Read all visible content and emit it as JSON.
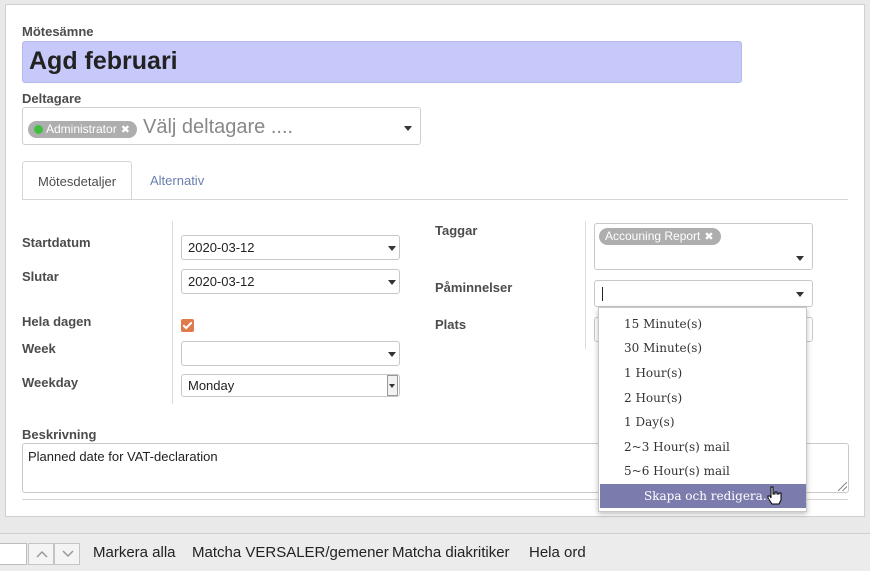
{
  "form": {
    "subject_label": "Mötesämne",
    "subject_value": "Agd februari",
    "attendees_label": "Deltagare",
    "attendee_tag": "Administrator",
    "attendees_placeholder": "Välj deltagare ....",
    "tabs": [
      "Mötesdetaljer",
      "Alternativ"
    ],
    "start_label": "Startdatum",
    "start_value": "2020-03-12",
    "stop_label": "Slutar",
    "stop_value": "2020-03-12",
    "allday_label": "Hela dagen",
    "allday_checked": true,
    "week_label": "Week",
    "week_value": "",
    "weekday_label": "Weekday",
    "weekday_value": "Monday",
    "tags_label": "Taggar",
    "tag_value": "Accouning Report",
    "reminders_label": "Påminnelser",
    "location_label": "Plats",
    "description_label": "Beskrivning",
    "description_value": "Planned date for VAT-declaration"
  },
  "reminder_dropdown": {
    "options": [
      "15 Minute(s)",
      "30 Minute(s)",
      "1 Hour(s)",
      "2 Hour(s)",
      "1 Day(s)",
      "2~3 Hour(s) mail",
      "5~6 Hour(s) mail"
    ],
    "create_label": "Skapa och redigera..."
  },
  "findbar": {
    "highlight_all": "Markera alla",
    "match_case": "Matcha VERSALER/gemener",
    "match_diacritics": "Matcha diakritiker",
    "whole_words": "Hela ord"
  },
  "colors": {
    "subject_bg": "#c6c9fa",
    "checkbox": "#e07a4b",
    "dropdown_highlight": "#7c7bad",
    "tab_link": "#6a7fb0"
  },
  "icons": [
    "remove-tag-icon",
    "dropdown-caret-icon",
    "checkmark-icon",
    "hand-cursor-icon",
    "chevron-up-icon",
    "chevron-down-icon",
    "resize-grip-icon"
  ]
}
